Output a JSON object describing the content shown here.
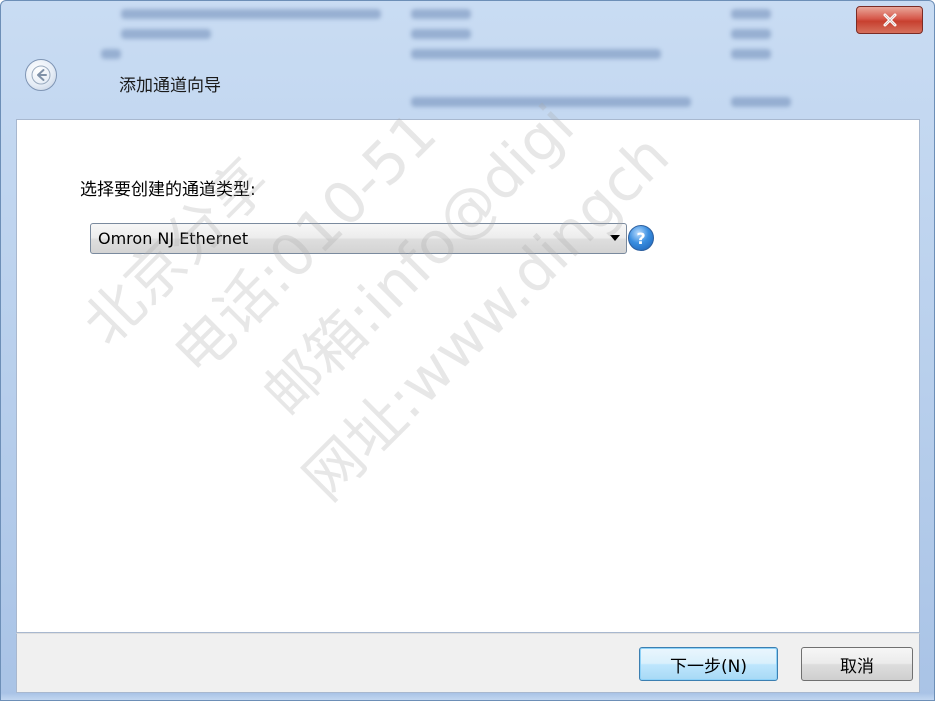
{
  "window": {
    "title": "添加通道向导",
    "close_symbol": "X"
  },
  "content": {
    "prompt_label": "选择要创建的通道类型:",
    "channel_type_select": {
      "selected_value": "Omron NJ Ethernet"
    },
    "help_symbol": "?"
  },
  "footer": {
    "next_label": "下一步(N)",
    "cancel_label": "取消"
  },
  "watermark_lines": [
    "北京分享",
    "电话:010-51",
    "邮箱:info@digi",
    "网址:www.dingch"
  ],
  "icons": {
    "back": "back-arrow-icon",
    "close": "close-icon",
    "dropdown": "chevron-down-icon",
    "help": "help-icon"
  },
  "colors": {
    "close_button": "#c7402f",
    "help_icon": "#1a5fb4",
    "aero_frame": "#b8cfec"
  }
}
